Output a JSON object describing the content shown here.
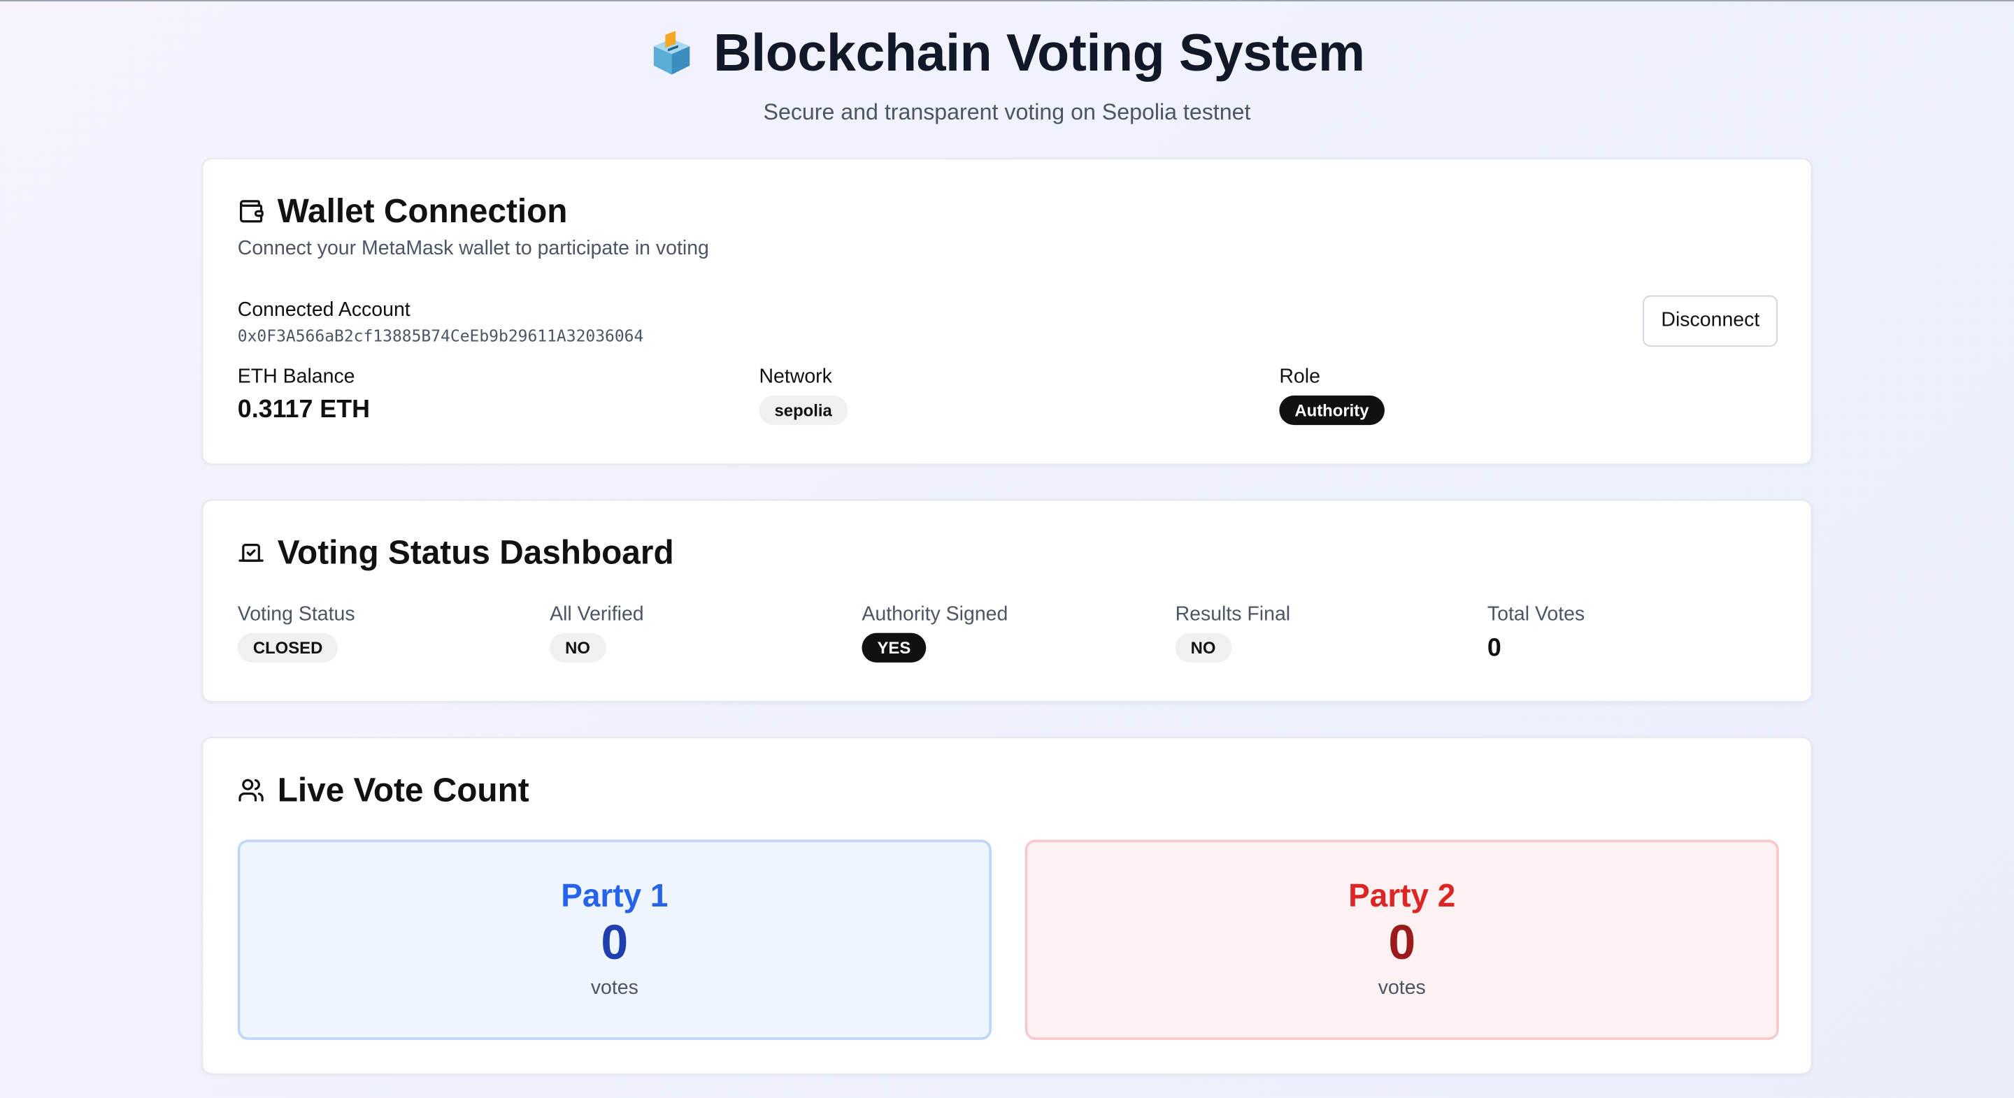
{
  "header": {
    "icon": "ballot-box-icon",
    "title": "Blockchain Voting System",
    "subtitle": "Secure and transparent voting on Sepolia testnet"
  },
  "wallet": {
    "icon": "wallet-icon",
    "title": "Wallet Connection",
    "description": "Connect your MetaMask wallet to participate in voting",
    "account_label": "Connected Account",
    "account_address": "0x0F3A566aB2cf13885B74CeEb9b29611A32036064",
    "disconnect_label": "Disconnect",
    "balance_label": "ETH Balance",
    "balance_value": "0.3117 ETH",
    "network_label": "Network",
    "network_value": "sepolia",
    "role_label": "Role",
    "role_value": "Authority"
  },
  "status": {
    "icon": "ballot-check-icon",
    "title": "Voting Status Dashboard",
    "voting_status_label": "Voting Status",
    "voting_status_value": "CLOSED",
    "all_verified_label": "All Verified",
    "all_verified_value": "NO",
    "authority_signed_label": "Authority Signed",
    "authority_signed_value": "YES",
    "results_final_label": "Results Final",
    "results_final_value": "NO",
    "total_votes_label": "Total Votes",
    "total_votes_value": "0"
  },
  "votes": {
    "icon": "users-icon",
    "title": "Live Vote Count",
    "parties": [
      {
        "name": "Party 1",
        "count": "0",
        "unit": "votes",
        "color": "#2563eb"
      },
      {
        "name": "Party 2",
        "count": "0",
        "unit": "votes",
        "color": "#dc2626"
      }
    ]
  }
}
